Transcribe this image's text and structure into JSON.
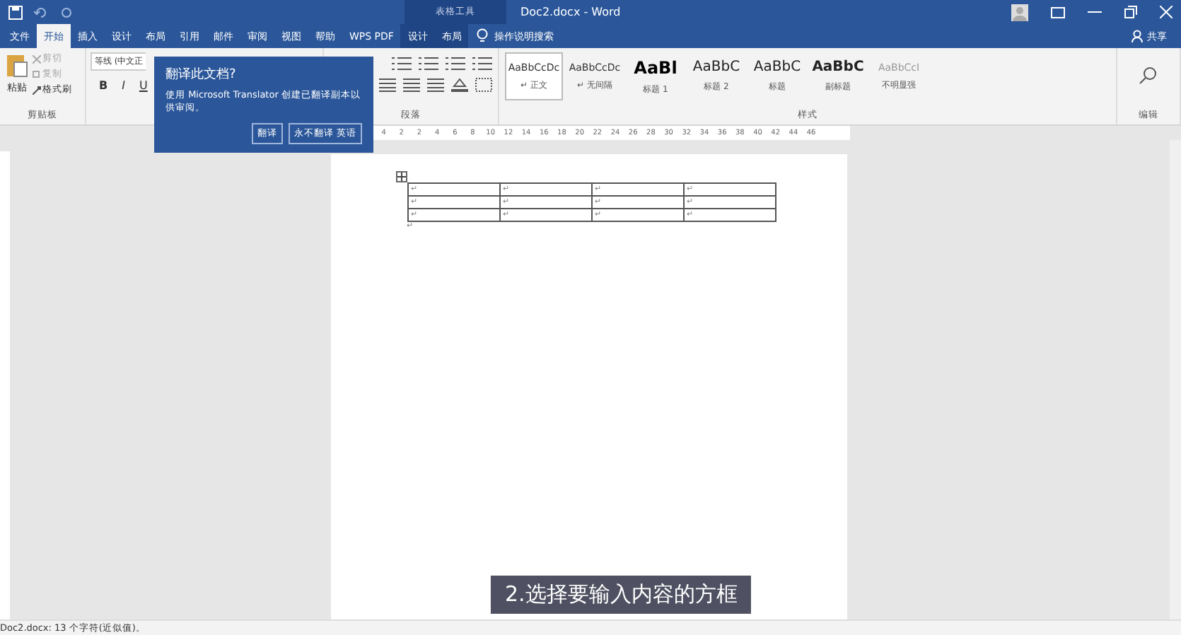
{
  "window": {
    "title": "Doc2.docx - Word",
    "context_label": "表格工具"
  },
  "tabs": [
    {
      "label": "文件",
      "selected": false
    },
    {
      "label": "开始",
      "selected": true
    },
    {
      "label": "插入",
      "selected": false
    },
    {
      "label": "设计",
      "selected": false
    },
    {
      "label": "布局",
      "selected": false
    },
    {
      "label": "引用",
      "selected": false
    },
    {
      "label": "邮件",
      "selected": false
    },
    {
      "label": "审阅",
      "selected": false
    },
    {
      "label": "视图",
      "selected": false
    },
    {
      "label": "帮助",
      "selected": false
    },
    {
      "label": "WPS PDF",
      "selected": false
    },
    {
      "label": "设计",
      "selected": false
    },
    {
      "label": "布局",
      "selected": false
    }
  ],
  "tell_me": "操作说明搜索",
  "share": "共享",
  "clipboard": {
    "paste": "粘贴",
    "cut": "剪切",
    "copy": "复制",
    "format_painter": "格式刷",
    "label": "剪贴板"
  },
  "font": {
    "name": "等线 (中文正",
    "bold": "B",
    "italic": "I",
    "underline": "U"
  },
  "paragraph_label": "段落",
  "styles": {
    "label": "样式",
    "items": [
      {
        "sample": "AaBbCcDc",
        "name": "↵ 正文",
        "selected": true,
        "kind": "normal"
      },
      {
        "sample": "AaBbCcDc",
        "name": "↵ 无间隔",
        "selected": false,
        "kind": "normal"
      },
      {
        "sample": "AaBl",
        "name": "标题 1",
        "selected": false,
        "kind": "h1"
      },
      {
        "sample": "AaBbC",
        "name": "标题 2",
        "selected": false,
        "kind": "h2"
      },
      {
        "sample": "AaBbC",
        "name": "标题",
        "selected": false,
        "kind": "h2"
      },
      {
        "sample": "AaBbC",
        "name": "副标题",
        "selected": false,
        "kind": "bold"
      },
      {
        "sample": "AaBbCcI",
        "name": "不明显强",
        "selected": false,
        "kind": "faint"
      }
    ]
  },
  "editing_label": "编辑",
  "translate_popup": {
    "title": "翻译此文档?",
    "text": "使用 Microsoft Translator 创建已翻译副本以供审阅。",
    "buttons": [
      "翻译",
      "永不翻译 英语"
    ]
  },
  "ruler": [
    "4",
    "2",
    "2",
    "4",
    "6",
    "8",
    "10",
    "12",
    "14",
    "16",
    "18",
    "20",
    "22",
    "24",
    "26",
    "28",
    "30",
    "32",
    "34",
    "36",
    "38",
    "40",
    "42",
    "44",
    "46"
  ],
  "table": {
    "rows": [
      [
        "↵",
        "↵",
        "↵",
        "↵"
      ],
      [
        "↵",
        "↵",
        "↵",
        "↵"
      ],
      [
        "↵",
        "↵",
        "↵",
        "↵"
      ]
    ],
    "after": "↵"
  },
  "caption": "2.选择要输入内容的方框",
  "status_bar": {
    "text": "Doc2.docx: 13 个字符(近似值)。"
  }
}
